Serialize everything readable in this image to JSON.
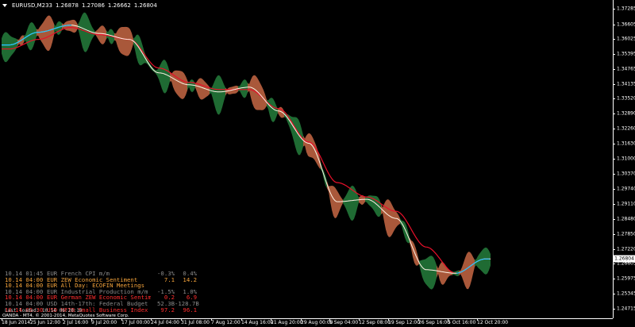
{
  "window": {
    "symbol": "EURUSD,M233",
    "open": "1.26878",
    "high": "1.27086",
    "low": "1.26662",
    "close": "1.26804"
  },
  "colors": {
    "background": "#000000",
    "axis": "#ffffff",
    "bull_band": "#1f6b33",
    "bear_band": "#a9583a",
    "ma_red": "#e8102a",
    "ma_white": "#fff3e6",
    "ma_cyan": "#22c4ff",
    "news_gray": "#8b8b8b",
    "news_orange": "#f2a23b",
    "news_red": "#ff2d2d"
  },
  "price_axis": {
    "labels": [
      "1.37285",
      "1.36605",
      "1.36025",
      "1.35395",
      "1.34765",
      "1.34135",
      "1.33520",
      "1.32890",
      "1.32260",
      "1.31630",
      "1.31000",
      "1.30370",
      "1.29740",
      "1.29110",
      "1.28480",
      "1.27850",
      "1.27220",
      "1.26804",
      "1.26605",
      "1.25975",
      "1.25345",
      "1.24715"
    ],
    "current": "1.26804"
  },
  "time_axis": {
    "labels": [
      "18 Jun 2014",
      "25 Jun 12:00",
      "2 Jul 16:00",
      "9 Jul 20:00",
      "17 Jul 00:00",
      "24 Jul 04:00",
      "31 Jul 08:00",
      "7 Aug 12:00",
      "14 Aug 16:00",
      "21 Aug 20:00",
      "29 Aug 00:00",
      "5 Sep 04:00",
      "12 Sep 08:00",
      "19 Sep 12:00",
      "26 Sep 16:00",
      "5 Oct 16:00",
      "12 Oct 20:00"
    ]
  },
  "news": {
    "rows": [
      {
        "time": "10.14 01:45",
        "event": "EUR French CPI m/m",
        "actual": "-0.3%",
        "forecast": "0.4%",
        "color": "gray"
      },
      {
        "time": "10.14 04:00",
        "event": "EUR ZEW Economic Sentiment",
        "actual": "7.1",
        "forecast": "14.2",
        "color": "orange"
      },
      {
        "time": "10.14 04:00",
        "event": "EUR All Day: ECOFIN Meetings",
        "actual": "",
        "forecast": "",
        "color": "orange"
      },
      {
        "time": "10.14 04:00",
        "event": "EUR Industrial Production m/m",
        "actual": "-1.5%",
        "forecast": "1.0%",
        "color": "gray"
      },
      {
        "time": "10.14 04:00",
        "event": "EUR German ZEW Economic Sentiment",
        "actual": "0.2",
        "forecast": "6.9",
        "color": "red"
      },
      {
        "time": "10.14 04:00",
        "event": "USD 14th-17th: Federal Budget Bala",
        "actual": "52.3B",
        "forecast": "-128.7B",
        "color": "gray"
      },
      {
        "time": "10.14 06:30",
        "event": "USD NFIB Small Business Index",
        "actual": "97.2",
        "forecast": "96.1",
        "color": "red"
      }
    ],
    "footer": "Last loaded: 10.14 06:20:10"
  },
  "copyright": "OANDA - MT4, © 2001-2014, MetaQuotes Software Corp.",
  "chart_data": {
    "type": "line",
    "xlabel": "",
    "ylabel": "",
    "ylim": [
      1.247,
      1.3765
    ],
    "x": [
      "18 Jun",
      "25 Jun",
      "2 Jul",
      "9 Jul",
      "17 Jul",
      "24 Jul",
      "31 Jul",
      "7 Aug",
      "14 Aug",
      "21 Aug",
      "29 Aug",
      "5 Sep",
      "12 Sep",
      "19 Sep",
      "26 Sep",
      "5 Oct",
      "12 Oct"
    ],
    "series": [
      {
        "values": [
          1.3577,
          1.363,
          1.366,
          1.3625,
          1.36,
          1.346,
          1.341,
          1.338,
          1.34,
          1.33,
          1.3165,
          1.292,
          1.293,
          1.285,
          1.2635,
          1.262,
          1.268
        ]
      },
      {
        "values": [
          1.356,
          1.36,
          1.365,
          1.362,
          1.36,
          1.348,
          1.342,
          1.339,
          1.339,
          1.331,
          1.317,
          1.3,
          1.294,
          1.288,
          1.273,
          1.262,
          1.268
        ]
      }
    ]
  }
}
